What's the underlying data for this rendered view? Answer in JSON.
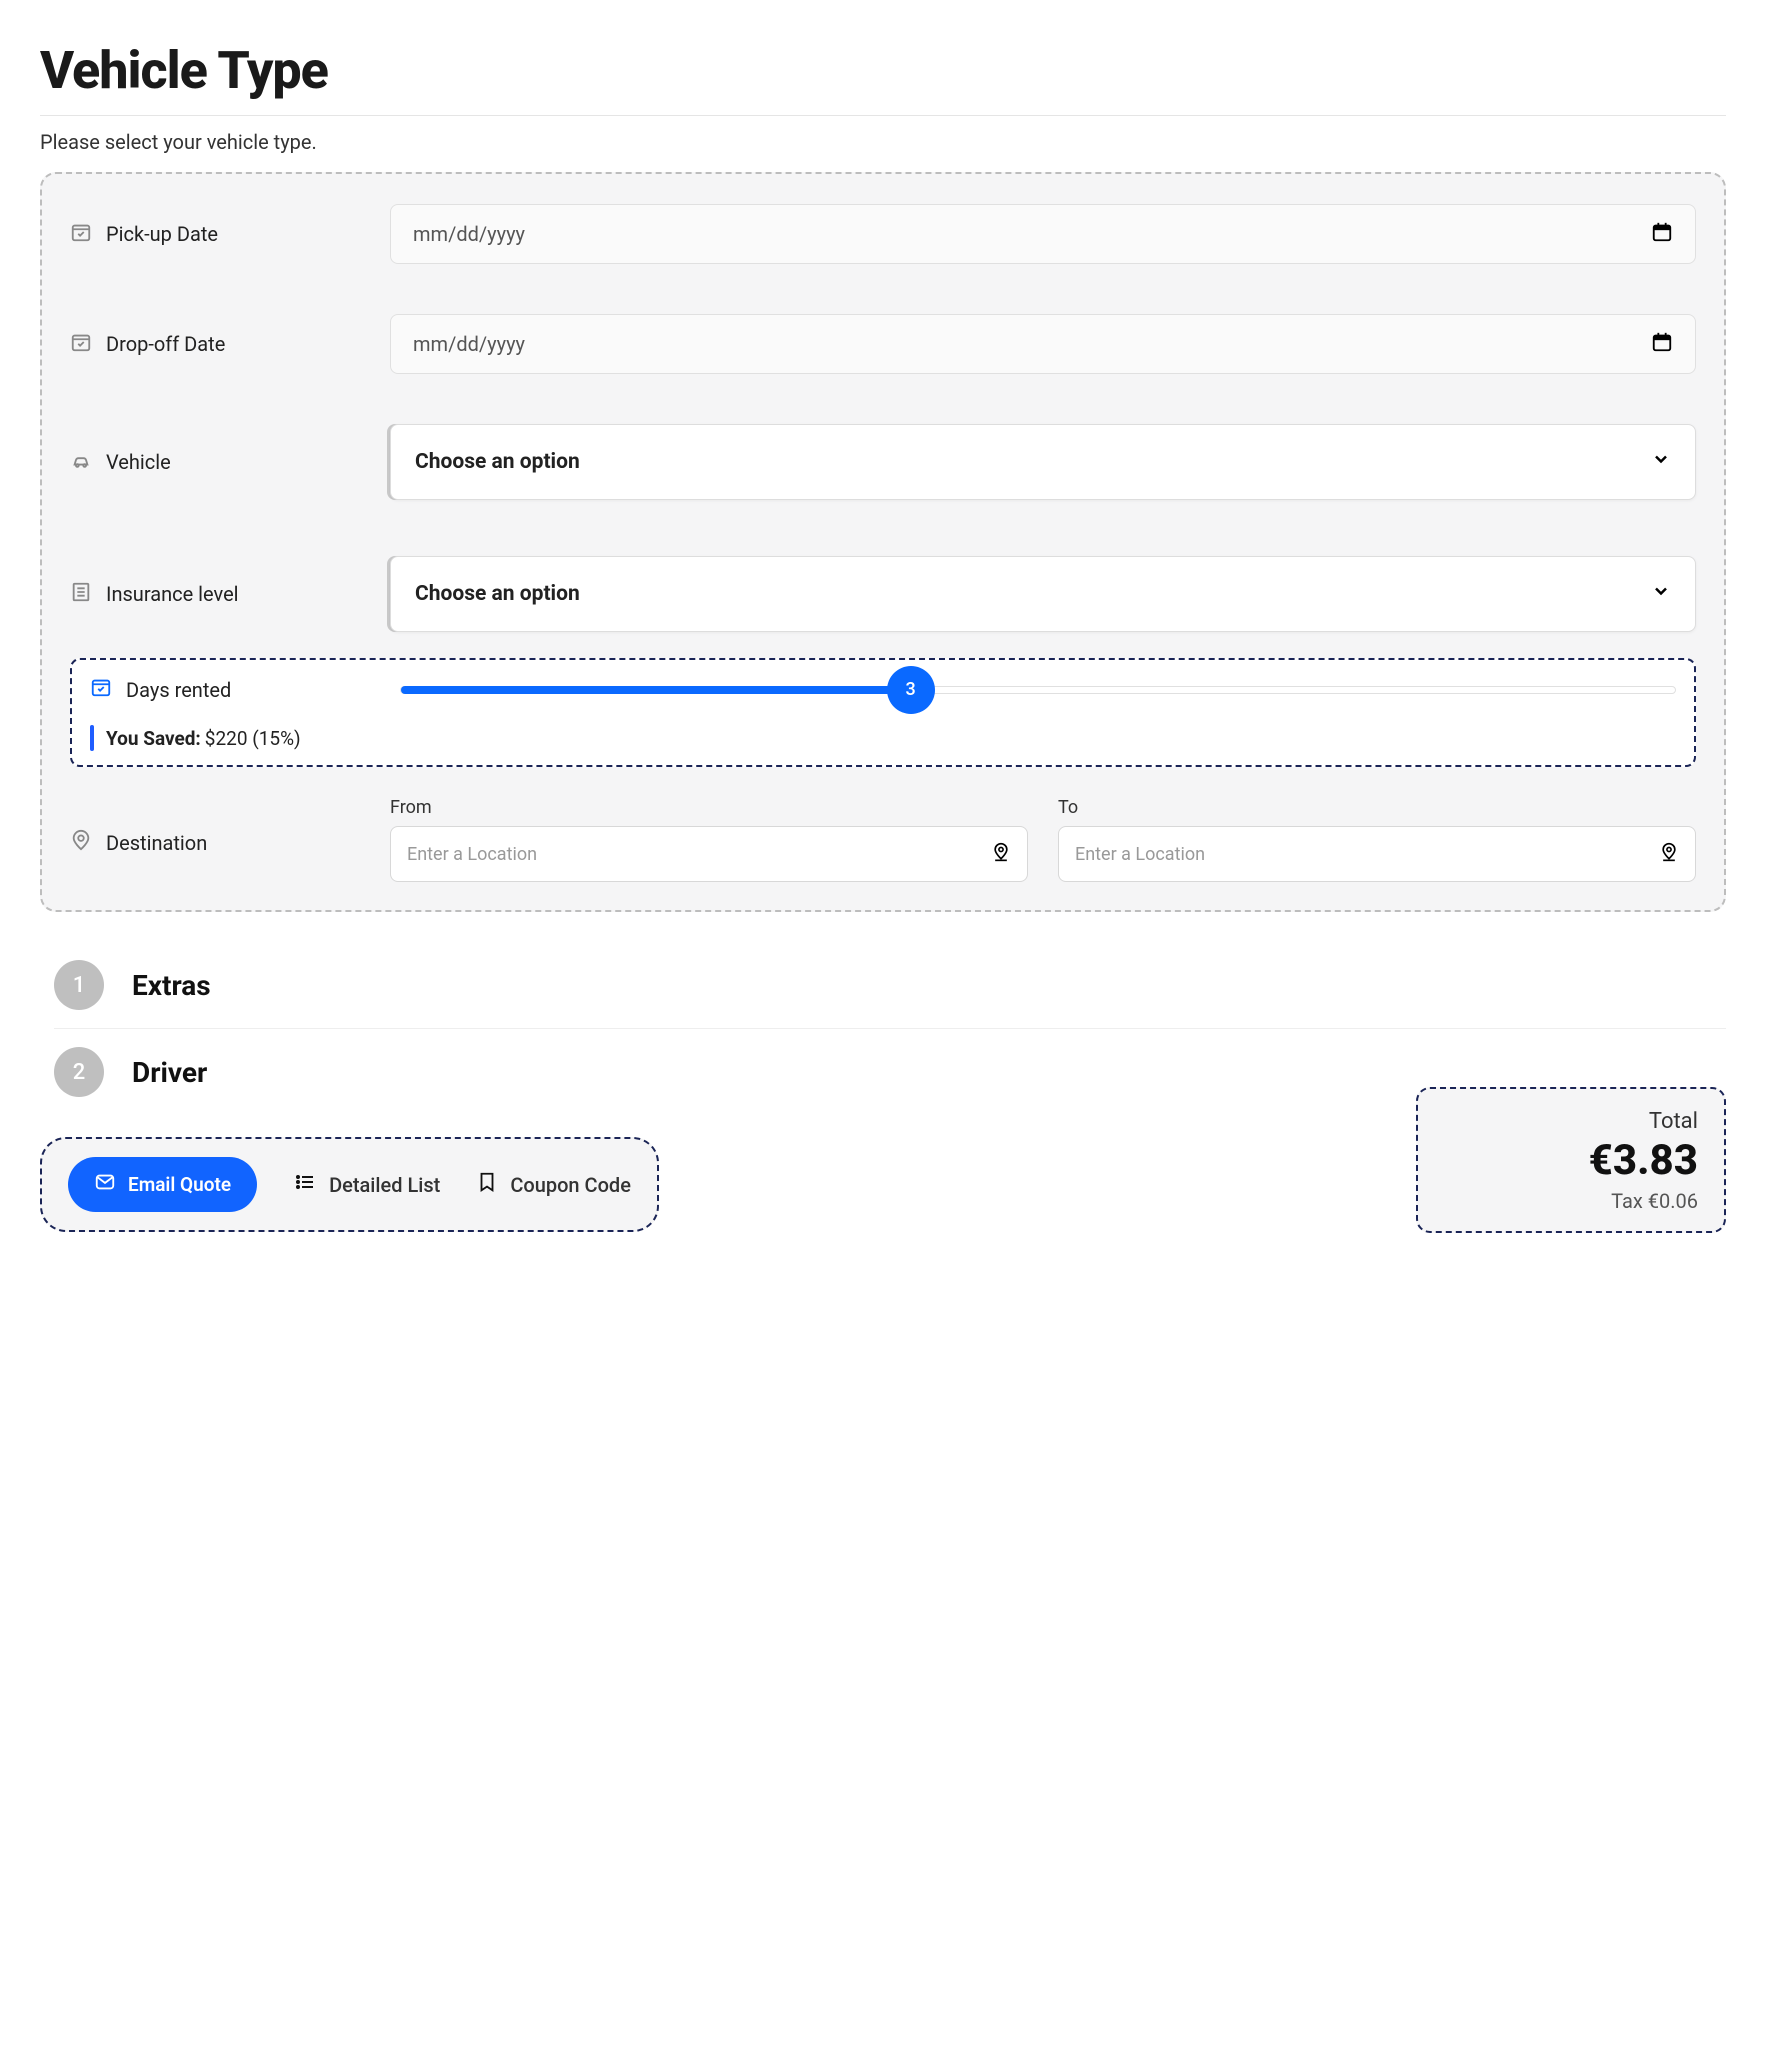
{
  "title": "Vehicle Type",
  "subtitle": "Please select your vehicle type.",
  "fields": {
    "pickup_label": "Pick-up Date",
    "pickup_placeholder": "mm/dd/yyyy",
    "dropoff_label": "Drop-off Date",
    "dropoff_placeholder": "mm/dd/yyyy",
    "vehicle_label": "Vehicle",
    "vehicle_selected": "Choose an option",
    "insurance_label": "Insurance level",
    "insurance_selected": "Choose an option"
  },
  "days": {
    "label": "Days rented",
    "value": "3",
    "percent": 40,
    "saved_label": "You Saved:",
    "saved_value": "$220 (15%)"
  },
  "destination": {
    "label": "Destination",
    "from_label": "From",
    "to_label": "To",
    "placeholder": "Enter a Location"
  },
  "steps": [
    {
      "num": "1",
      "title": "Extras"
    },
    {
      "num": "2",
      "title": "Driver"
    }
  ],
  "actions": {
    "email": "Email Quote",
    "detailed": "Detailed List",
    "coupon": "Coupon Code"
  },
  "totals": {
    "total_label": "Total",
    "total_value": "€3.83",
    "tax_value": "Tax €0.06"
  }
}
